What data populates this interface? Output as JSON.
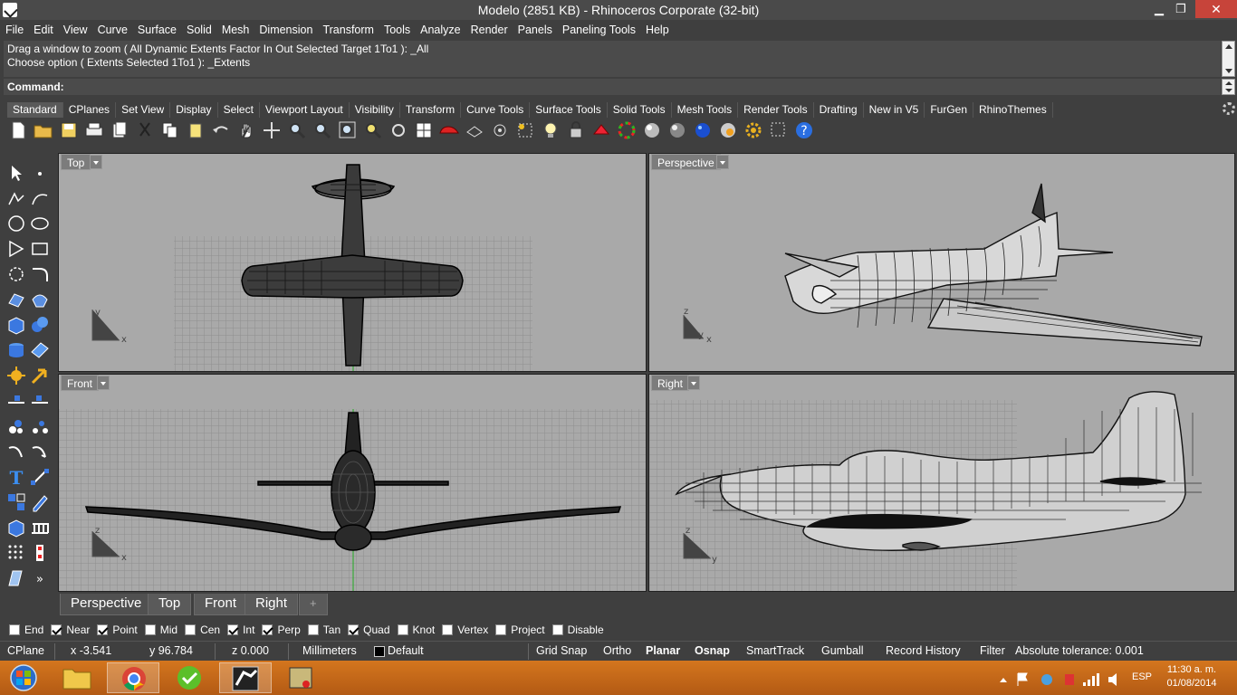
{
  "window": {
    "title": "Modelo (2851 KB) - Rhinoceros Corporate (32-bit)",
    "minimize": "▁",
    "restore": "❐",
    "close": "✕"
  },
  "menu": [
    "File",
    "Edit",
    "View",
    "Curve",
    "Surface",
    "Solid",
    "Mesh",
    "Dimension",
    "Transform",
    "Tools",
    "Analyze",
    "Render",
    "Panels",
    "Paneling Tools",
    "Help"
  ],
  "command": {
    "history_line1": "Drag a window to zoom ( All  Dynamic  Extents  Factor  In  Out  Selected  Target  1To1 ): _All",
    "history_line2": "Choose option ( Extents  Selected  1To1 ): _Extents",
    "prompt": "Command:"
  },
  "toolbar_tabs": [
    "Standard",
    "CPlanes",
    "Set View",
    "Display",
    "Select",
    "Viewport Layout",
    "Visibility",
    "Transform",
    "Curve Tools",
    "Surface Tools",
    "Solid Tools",
    "Mesh Tools",
    "Render Tools",
    "Drafting",
    "New in V5",
    "FurGen",
    "RhinoThemes"
  ],
  "active_toolbar_tab": "Standard",
  "toolbar_icons": [
    "new-file",
    "open-folder",
    "save",
    "print",
    "paste-doc",
    "cut",
    "copy",
    "paste",
    "undo",
    "pan-hand",
    "move",
    "zoom",
    "zoom-window",
    "zoom-extents",
    "zoom-selected",
    "rotate-view",
    "viewport-layout",
    "car-render",
    "wireframe",
    "target",
    "light",
    "lock",
    "material",
    "color-wheel",
    "shade-sphere",
    "render-sphere",
    "blue-sphere",
    "rendered-sphere",
    "settings-gear",
    "dashed-select",
    "help"
  ],
  "viewports": {
    "top": {
      "label": "Top",
      "axis_a": "y",
      "axis_b": "x"
    },
    "perspective": {
      "label": "Perspective",
      "axis_a": "z",
      "axis_b": "y",
      "axis_c": "x"
    },
    "front": {
      "label": "Front",
      "axis_a": "z",
      "axis_b": "x"
    },
    "right": {
      "label": "Right",
      "axis_a": "z",
      "axis_b": "y"
    }
  },
  "viewport_tabs": [
    "Perspective",
    "Top",
    "Front",
    "Right",
    "+"
  ],
  "osnaps": [
    {
      "label": "End",
      "checked": false
    },
    {
      "label": "Near",
      "checked": true
    },
    {
      "label": "Point",
      "checked": true
    },
    {
      "label": "Mid",
      "checked": false
    },
    {
      "label": "Cen",
      "checked": false
    },
    {
      "label": "Int",
      "checked": true
    },
    {
      "label": "Perp",
      "checked": true
    },
    {
      "label": "Tan",
      "checked": false
    },
    {
      "label": "Quad",
      "checked": true
    },
    {
      "label": "Knot",
      "checked": false
    },
    {
      "label": "Vertex",
      "checked": false
    },
    {
      "label": "Project",
      "checked": false
    },
    {
      "label": "Disable",
      "checked": false
    }
  ],
  "status": {
    "cplane": "CPlane",
    "x": "x -3.541",
    "y": "y 96.784",
    "z": "z 0.000",
    "units": "Millimeters",
    "layer": "Default",
    "grid_snap": "Grid Snap",
    "ortho": "Ortho",
    "planar": "Planar",
    "osnap": "Osnap",
    "smarttrack": "SmartTrack",
    "gumball": "Gumball",
    "record_history": "Record History",
    "filter": "Filter",
    "tolerance": "Absolute tolerance: 0.001"
  },
  "taskbar": {
    "apps": [
      "start",
      "file-explorer",
      "chrome",
      "green-app",
      "rhino",
      "rhino-render"
    ],
    "language": "ESP",
    "time": "11:30 a. m.",
    "date": "01/08/2014"
  },
  "colors": {
    "viewport_bg": "#a9a9a9",
    "grid": "#8e8e8e",
    "wire": "#000000",
    "taskbar": "#c86a1a",
    "close": "#c7443a"
  }
}
